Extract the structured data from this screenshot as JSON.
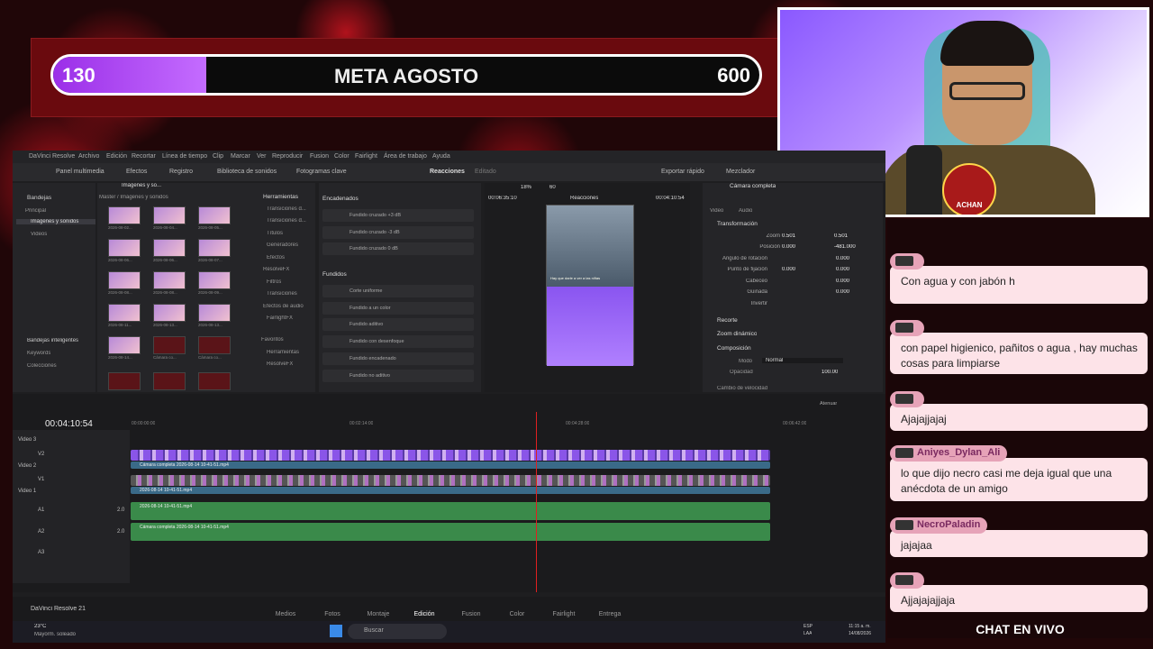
{
  "goal": {
    "current": "130",
    "title": "META AGOSTO",
    "target": "600",
    "progress": 0.217
  },
  "cam_logo": "ACHAN",
  "chat": {
    "title": "CHAT EN VIVO",
    "messages": [
      {
        "user": "",
        "text": "Con agua y con jabón h"
      },
      {
        "user": "",
        "text": "con papel higienico, pañitos o agua , hay muchas cosas para limpiarse"
      },
      {
        "user": "",
        "text": "Ajajajjajaj"
      },
      {
        "user": "Aniyes_Dylan_Ali",
        "text": "lo que dijo necro casi me deja igual que una anécdota de un amigo"
      },
      {
        "user": "NecroPaladin",
        "text": "jajajaa"
      },
      {
        "user": "",
        "text": "Ajjajajajjaja"
      }
    ]
  },
  "resolve": {
    "menu": [
      "DaVinci Resolve",
      "Archivo",
      "Edición",
      "Recortar",
      "Línea de tiempo",
      "Clip",
      "Marcar",
      "Ver",
      "Reproducir",
      "Fusion",
      "Color",
      "Fairlight",
      "Área de trabajo",
      "Ayuda"
    ],
    "toolbar": {
      "media_pool": "Panel multimedia",
      "effects": "Efectos",
      "index": "Registro",
      "sound": "Biblioteca de sonidos",
      "keyframes": "Fotogramas clave",
      "project": "Reacciones",
      "edited": "Editado",
      "export": "Exportar rápido",
      "mixer": "Mezclador"
    },
    "bins": {
      "header": "Bandejas",
      "master": "Master / Imágenes y sonidos",
      "current": "Imágenes y so...",
      "items": [
        "Principal",
        "Imágenes y sonidos",
        "Videos"
      ],
      "smart": "Bandejas inteligentes",
      "smart_items": [
        "Keywords",
        "Colecciones"
      ]
    },
    "thumbs": [
      "2026-08-02...",
      "2026-08-04...",
      "2026-08-05...",
      "2026-08-06...",
      "2026-08-06...",
      "2026-08-07...",
      "2026-08-08...",
      "2026-08-08...",
      "2026-08-09...",
      "2026-08-11...",
      "2026-08-13...",
      "2026-08-13...",
      "2026-08-14...",
      "Cámara co...",
      "Cámara co..."
    ],
    "fx_tree": {
      "header": "Herramientas",
      "items": [
        "Transiciones d...",
        "Transiciones d...",
        "Títulos",
        "Generadores",
        "Efectos",
        "ResolveFX",
        "Filtros",
        "Transiciones",
        "Efectos de audio",
        "FairlightFX",
        "Favoritos",
        "Herramientas",
        "ResolveFX"
      ]
    },
    "fx_list": {
      "crossfades_header": "Encadenados",
      "crossfades": [
        "Fundido cruzado +3 dB",
        "Fundido cruzado -3 dB",
        "Fundido cruzado 0 dB"
      ],
      "fades_header": "Fundidos",
      "fades": [
        "Corte uniforme",
        "Fundido a un color",
        "Fundido aditivo",
        "Fundido con desenfoque",
        "Fundido encadenado",
        "Fundido no aditivo"
      ]
    },
    "viewer": {
      "zoom": "18%",
      "fps": "60",
      "tc_left": "00:06:35:10",
      "title": "Reacciones",
      "tc_right": "00:04:10:54",
      "caption": "Hay que darle a ver a las niñas"
    },
    "inspector": {
      "title": "Cámara completa",
      "tabs": [
        "Video",
        "Audio"
      ],
      "section": "Transformación",
      "rows": [
        {
          "label": "Zoom",
          "x": "0.501",
          "y": "0.501"
        },
        {
          "label": "Posición",
          "x": "0.000",
          "y": "-481.000"
        },
        {
          "label": "Ángulo de rotación",
          "x": "",
          "y": "0.000"
        },
        {
          "label": "Punto de fijación",
          "x": "0.000",
          "y": "0.000"
        },
        {
          "label": "Cabeceo",
          "x": "",
          "y": "0.000"
        },
        {
          "label": "Guiñada",
          "x": "",
          "y": "0.000"
        },
        {
          "label": "Invertir",
          "x": "",
          "y": ""
        }
      ],
      "sections": [
        "Recorte",
        "Zoom dinámico",
        "Composición",
        "Cambio de velocidad"
      ],
      "mode_label": "Modo",
      "mode_value": "Normal",
      "opacity_label": "Opacidad",
      "opacity_value": "100.00"
    },
    "timeline": {
      "timecode": "00:04:10:54",
      "ruler": [
        "00:00:00:00",
        "00:02:14:00",
        "00:04:28:00",
        "00:06:42:00"
      ],
      "tracks": [
        "Video 3",
        "V2",
        "Video 2",
        "V1",
        "Video 1",
        "A1",
        "A2",
        "A3"
      ],
      "clip_v2": "Cámara completa 2026-08-14 10-41-51.mp4",
      "clip_v1": "2026-08-14 10-41-51.mp4",
      "clip_a1": "2026-08-14 10-41-51.mp4",
      "clip_a2": "Cámara completa 2026-08-14 10-41-51.mp4",
      "audio_level": "2.0",
      "attenuate": "Atenuar"
    },
    "app_name": "DaVinci Resolve 21",
    "pages": [
      "Medios",
      "Fotos",
      "Montaje",
      "Edición",
      "Fusion",
      "Color",
      "Fairlight",
      "Entrega"
    ]
  },
  "taskbar": {
    "weather": "23°C",
    "weather_desc": "Mayorm. soleado",
    "search": "Buscar",
    "lang": "ESP",
    "lang2": "LAA",
    "time": "11:15 a. m.",
    "date": "14/08/2026"
  }
}
